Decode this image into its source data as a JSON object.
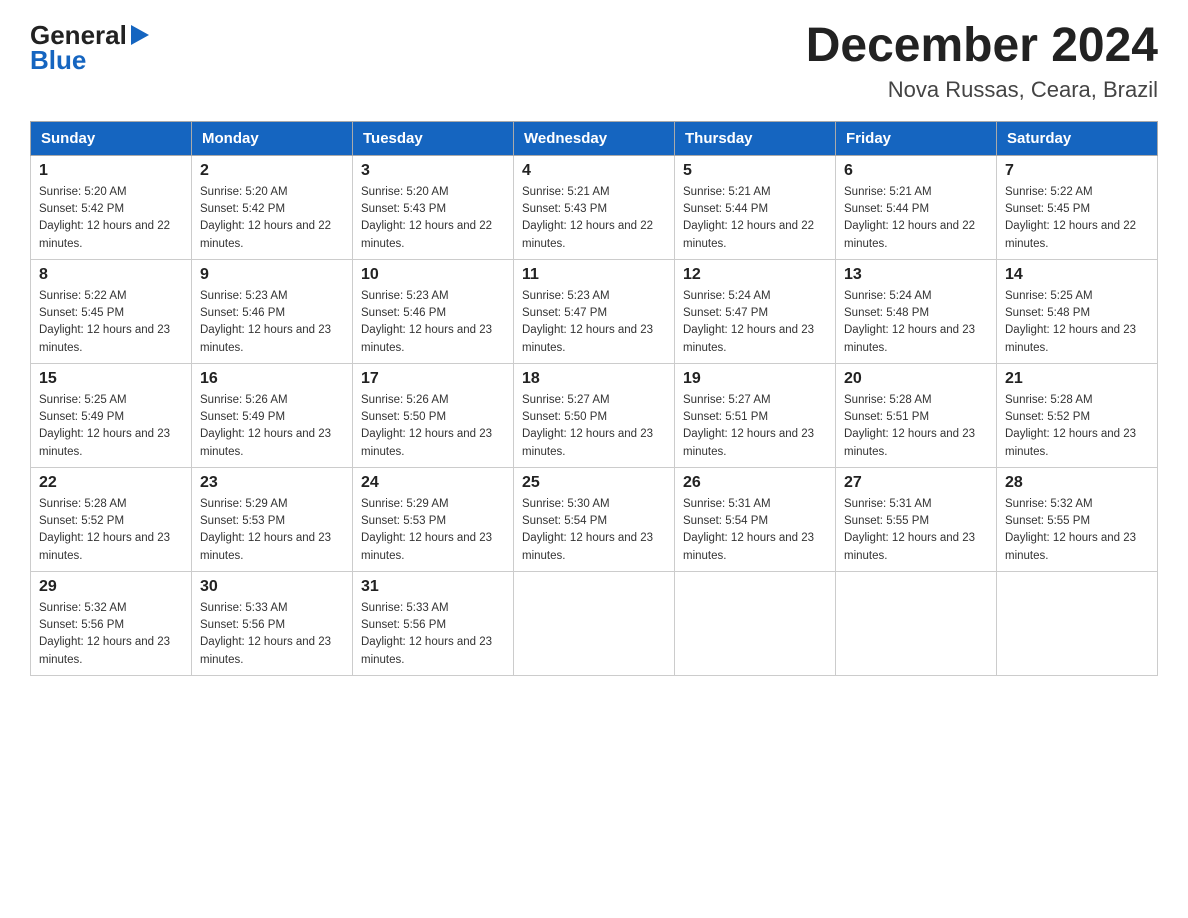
{
  "logo": {
    "general": "General",
    "blue": "Blue",
    "arrow_char": "▶"
  },
  "title": "December 2024",
  "subtitle": "Nova Russas, Ceara, Brazil",
  "days_of_week": [
    "Sunday",
    "Monday",
    "Tuesday",
    "Wednesday",
    "Thursday",
    "Friday",
    "Saturday"
  ],
  "weeks": [
    [
      {
        "day": "1",
        "sunrise": "5:20 AM",
        "sunset": "5:42 PM",
        "daylight": "12 hours and 22 minutes."
      },
      {
        "day": "2",
        "sunrise": "5:20 AM",
        "sunset": "5:42 PM",
        "daylight": "12 hours and 22 minutes."
      },
      {
        "day": "3",
        "sunrise": "5:20 AM",
        "sunset": "5:43 PM",
        "daylight": "12 hours and 22 minutes."
      },
      {
        "day": "4",
        "sunrise": "5:21 AM",
        "sunset": "5:43 PM",
        "daylight": "12 hours and 22 minutes."
      },
      {
        "day": "5",
        "sunrise": "5:21 AM",
        "sunset": "5:44 PM",
        "daylight": "12 hours and 22 minutes."
      },
      {
        "day": "6",
        "sunrise": "5:21 AM",
        "sunset": "5:44 PM",
        "daylight": "12 hours and 22 minutes."
      },
      {
        "day": "7",
        "sunrise": "5:22 AM",
        "sunset": "5:45 PM",
        "daylight": "12 hours and 22 minutes."
      }
    ],
    [
      {
        "day": "8",
        "sunrise": "5:22 AM",
        "sunset": "5:45 PM",
        "daylight": "12 hours and 23 minutes."
      },
      {
        "day": "9",
        "sunrise": "5:23 AM",
        "sunset": "5:46 PM",
        "daylight": "12 hours and 23 minutes."
      },
      {
        "day": "10",
        "sunrise": "5:23 AM",
        "sunset": "5:46 PM",
        "daylight": "12 hours and 23 minutes."
      },
      {
        "day": "11",
        "sunrise": "5:23 AM",
        "sunset": "5:47 PM",
        "daylight": "12 hours and 23 minutes."
      },
      {
        "day": "12",
        "sunrise": "5:24 AM",
        "sunset": "5:47 PM",
        "daylight": "12 hours and 23 minutes."
      },
      {
        "day": "13",
        "sunrise": "5:24 AM",
        "sunset": "5:48 PM",
        "daylight": "12 hours and 23 minutes."
      },
      {
        "day": "14",
        "sunrise": "5:25 AM",
        "sunset": "5:48 PM",
        "daylight": "12 hours and 23 minutes."
      }
    ],
    [
      {
        "day": "15",
        "sunrise": "5:25 AM",
        "sunset": "5:49 PM",
        "daylight": "12 hours and 23 minutes."
      },
      {
        "day": "16",
        "sunrise": "5:26 AM",
        "sunset": "5:49 PM",
        "daylight": "12 hours and 23 minutes."
      },
      {
        "day": "17",
        "sunrise": "5:26 AM",
        "sunset": "5:50 PM",
        "daylight": "12 hours and 23 minutes."
      },
      {
        "day": "18",
        "sunrise": "5:27 AM",
        "sunset": "5:50 PM",
        "daylight": "12 hours and 23 minutes."
      },
      {
        "day": "19",
        "sunrise": "5:27 AM",
        "sunset": "5:51 PM",
        "daylight": "12 hours and 23 minutes."
      },
      {
        "day": "20",
        "sunrise": "5:28 AM",
        "sunset": "5:51 PM",
        "daylight": "12 hours and 23 minutes."
      },
      {
        "day": "21",
        "sunrise": "5:28 AM",
        "sunset": "5:52 PM",
        "daylight": "12 hours and 23 minutes."
      }
    ],
    [
      {
        "day": "22",
        "sunrise": "5:28 AM",
        "sunset": "5:52 PM",
        "daylight": "12 hours and 23 minutes."
      },
      {
        "day": "23",
        "sunrise": "5:29 AM",
        "sunset": "5:53 PM",
        "daylight": "12 hours and 23 minutes."
      },
      {
        "day": "24",
        "sunrise": "5:29 AM",
        "sunset": "5:53 PM",
        "daylight": "12 hours and 23 minutes."
      },
      {
        "day": "25",
        "sunrise": "5:30 AM",
        "sunset": "5:54 PM",
        "daylight": "12 hours and 23 minutes."
      },
      {
        "day": "26",
        "sunrise": "5:31 AM",
        "sunset": "5:54 PM",
        "daylight": "12 hours and 23 minutes."
      },
      {
        "day": "27",
        "sunrise": "5:31 AM",
        "sunset": "5:55 PM",
        "daylight": "12 hours and 23 minutes."
      },
      {
        "day": "28",
        "sunrise": "5:32 AM",
        "sunset": "5:55 PM",
        "daylight": "12 hours and 23 minutes."
      }
    ],
    [
      {
        "day": "29",
        "sunrise": "5:32 AM",
        "sunset": "5:56 PM",
        "daylight": "12 hours and 23 minutes."
      },
      {
        "day": "30",
        "sunrise": "5:33 AM",
        "sunset": "5:56 PM",
        "daylight": "12 hours and 23 minutes."
      },
      {
        "day": "31",
        "sunrise": "5:33 AM",
        "sunset": "5:56 PM",
        "daylight": "12 hours and 23 minutes."
      },
      null,
      null,
      null,
      null
    ]
  ]
}
